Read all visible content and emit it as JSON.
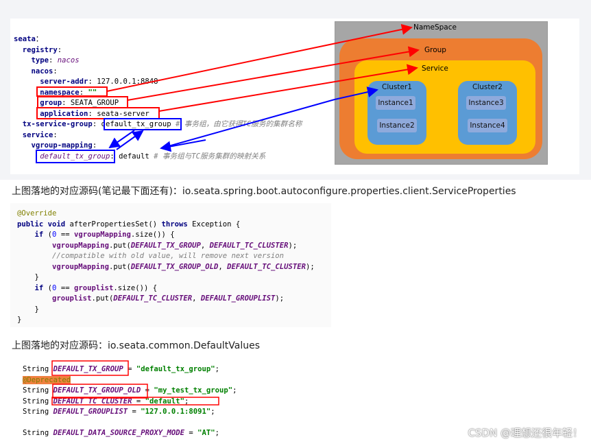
{
  "yaml_lines": [
    [
      [
        "key",
        "seata"
      ],
      [
        "",
        "："
      ]
    ],
    [
      [
        "",
        "  "
      ],
      [
        "key",
        "registry"
      ],
      [
        "",
        ":"
      ]
    ],
    [
      [
        "",
        "    "
      ],
      [
        "key",
        "type"
      ],
      [
        "",
        ": "
      ],
      [
        "ital",
        "nacos"
      ]
    ],
    [
      [
        "",
        "    "
      ],
      [
        "key",
        "nacos"
      ],
      [
        "",
        ":"
      ]
    ],
    [
      [
        "",
        "      "
      ],
      [
        "key",
        "server-addr"
      ],
      [
        "",
        ": 127.0.0.1:8848"
      ]
    ],
    [
      [
        "",
        "      "
      ],
      [
        "key",
        "namespace"
      ],
      [
        "",
        ": "
      ],
      [
        "str",
        "\"\""
      ]
    ],
    [
      [
        "",
        "      "
      ],
      [
        "key",
        "group"
      ],
      [
        "",
        ": SEATA_GROUP"
      ]
    ],
    [
      [
        "",
        "      "
      ],
      [
        "key",
        "application"
      ],
      [
        "",
        ": seata-server"
      ]
    ],
    [
      [
        "",
        "  "
      ],
      [
        "key",
        "tx-service-group"
      ],
      [
        "",
        ": default_tx_group "
      ],
      [
        "cmt",
        "# 事务组，由它获得TC服务的集群名称"
      ]
    ],
    [
      [
        "",
        "  "
      ],
      [
        "key",
        "service"
      ],
      [
        "",
        ":"
      ]
    ],
    [
      [
        "",
        "    "
      ],
      [
        "key",
        "vgroup-mapping"
      ],
      [
        "",
        ":"
      ]
    ],
    [
      [
        "",
        "      "
      ],
      [
        "ital",
        "default_tx_group"
      ],
      [
        "",
        ": default "
      ],
      [
        "cmt",
        "# 事务组与TC服务集群的映射关系"
      ]
    ]
  ],
  "diagram": {
    "namespace": "NameSpace",
    "group": "Group",
    "service": "Service",
    "cluster1": "Cluster1",
    "cluster2": "Cluster2",
    "instances": [
      "Instance1",
      "Instance2",
      "Instance3",
      "Instance4"
    ]
  },
  "para1": "上图落地的对应源码(笔记最下面还有)：io.seata.spring.boot.autoconfigure.properties.client.ServiceProperties",
  "java1": [
    [
      [
        "ann",
        "@Override"
      ]
    ],
    [
      [
        "kw",
        "public void "
      ],
      [
        "",
        "afterPropertiesSet() "
      ],
      [
        "kw",
        "throws "
      ],
      [
        "",
        "Exception {"
      ]
    ],
    [
      [
        "",
        "    "
      ],
      [
        "kw",
        "if "
      ],
      [
        "",
        "("
      ],
      [
        "num",
        "0"
      ],
      [
        "",
        " == "
      ],
      [
        "fld",
        "vgroupMapping"
      ],
      [
        "",
        ".size()) {"
      ]
    ],
    [
      [
        "",
        "        "
      ],
      [
        "fld",
        "vgroupMapping"
      ],
      [
        "",
        ".put("
      ],
      [
        "italb",
        "DEFAULT_TX_GROUP"
      ],
      [
        "",
        ", "
      ],
      [
        "italb",
        "DEFAULT_TC_CLUSTER"
      ],
      [
        "",
        ");"
      ]
    ],
    [
      [
        "",
        "        "
      ],
      [
        "cmt",
        "//compatible with old value, will remove next version"
      ]
    ],
    [
      [
        "",
        "        "
      ],
      [
        "fld",
        "vgroupMapping"
      ],
      [
        "",
        ".put("
      ],
      [
        "italb",
        "DEFAULT_TX_GROUP_OLD"
      ],
      [
        "",
        ", "
      ],
      [
        "italb",
        "DEFAULT_TC_CLUSTER"
      ],
      [
        "",
        ");"
      ]
    ],
    [
      [
        "",
        "    }"
      ]
    ],
    [
      [
        "",
        "    "
      ],
      [
        "kw",
        "if "
      ],
      [
        "",
        "("
      ],
      [
        "num",
        "0"
      ],
      [
        "",
        " == "
      ],
      [
        "fld",
        "grouplist"
      ],
      [
        "",
        ".size()) {"
      ]
    ],
    [
      [
        "",
        "        "
      ],
      [
        "fld",
        "grouplist"
      ],
      [
        "",
        ".put("
      ],
      [
        "italb",
        "DEFAULT_TC_CLUSTER"
      ],
      [
        "",
        ", "
      ],
      [
        "italb",
        "DEFAULT_GROUPLIST"
      ],
      [
        "",
        ");"
      ]
    ],
    [
      [
        "",
        "    }"
      ]
    ],
    [
      [
        "",
        "}"
      ]
    ]
  ],
  "para2": "上图落地的对应源码：io.seata.common.DefaultValues",
  "java2": [
    [
      [
        "",
        "String "
      ],
      [
        "italb",
        "DEFAULT_TX_GROUP"
      ],
      [
        "",
        " = "
      ],
      [
        "str",
        "\"default_tx_group\""
      ],
      [
        "",
        ";"
      ]
    ],
    [
      [
        "dep",
        "@Deprecated"
      ]
    ],
    [
      [
        "",
        "String "
      ],
      [
        "italb",
        "DEFAULT_TX_GROUP_OLD"
      ],
      [
        "",
        " = "
      ],
      [
        "str",
        "\"my_test_tx_group\""
      ],
      [
        "",
        ";"
      ]
    ],
    [
      [
        "",
        "String "
      ],
      [
        "italb",
        "DEFAULT_TC_CLUSTER"
      ],
      [
        "",
        " = "
      ],
      [
        "str",
        "\"default\""
      ],
      [
        "",
        ";"
      ]
    ],
    [
      [
        "",
        "String "
      ],
      [
        "italb",
        "DEFAULT_GROUPLIST"
      ],
      [
        "",
        " = "
      ],
      [
        "str",
        "\"127.0.0.1:8091\""
      ],
      [
        "",
        ";"
      ]
    ],
    [
      [
        "",
        ""
      ]
    ],
    [
      [
        "",
        "String "
      ],
      [
        "italb",
        "DEFAULT_DATA_SOURCE_PROXY_MODE"
      ],
      [
        "",
        " = "
      ],
      [
        "str",
        "\"AT\""
      ],
      [
        "",
        ";"
      ]
    ]
  ],
  "watermark": "CSDN @理想还很年轻！",
  "colors": {
    "highlight_red": "#ff0000",
    "highlight_blue": "#0000ff",
    "group": "#ed7d31",
    "service": "#ffc000",
    "cluster": "#5b9bd5"
  }
}
